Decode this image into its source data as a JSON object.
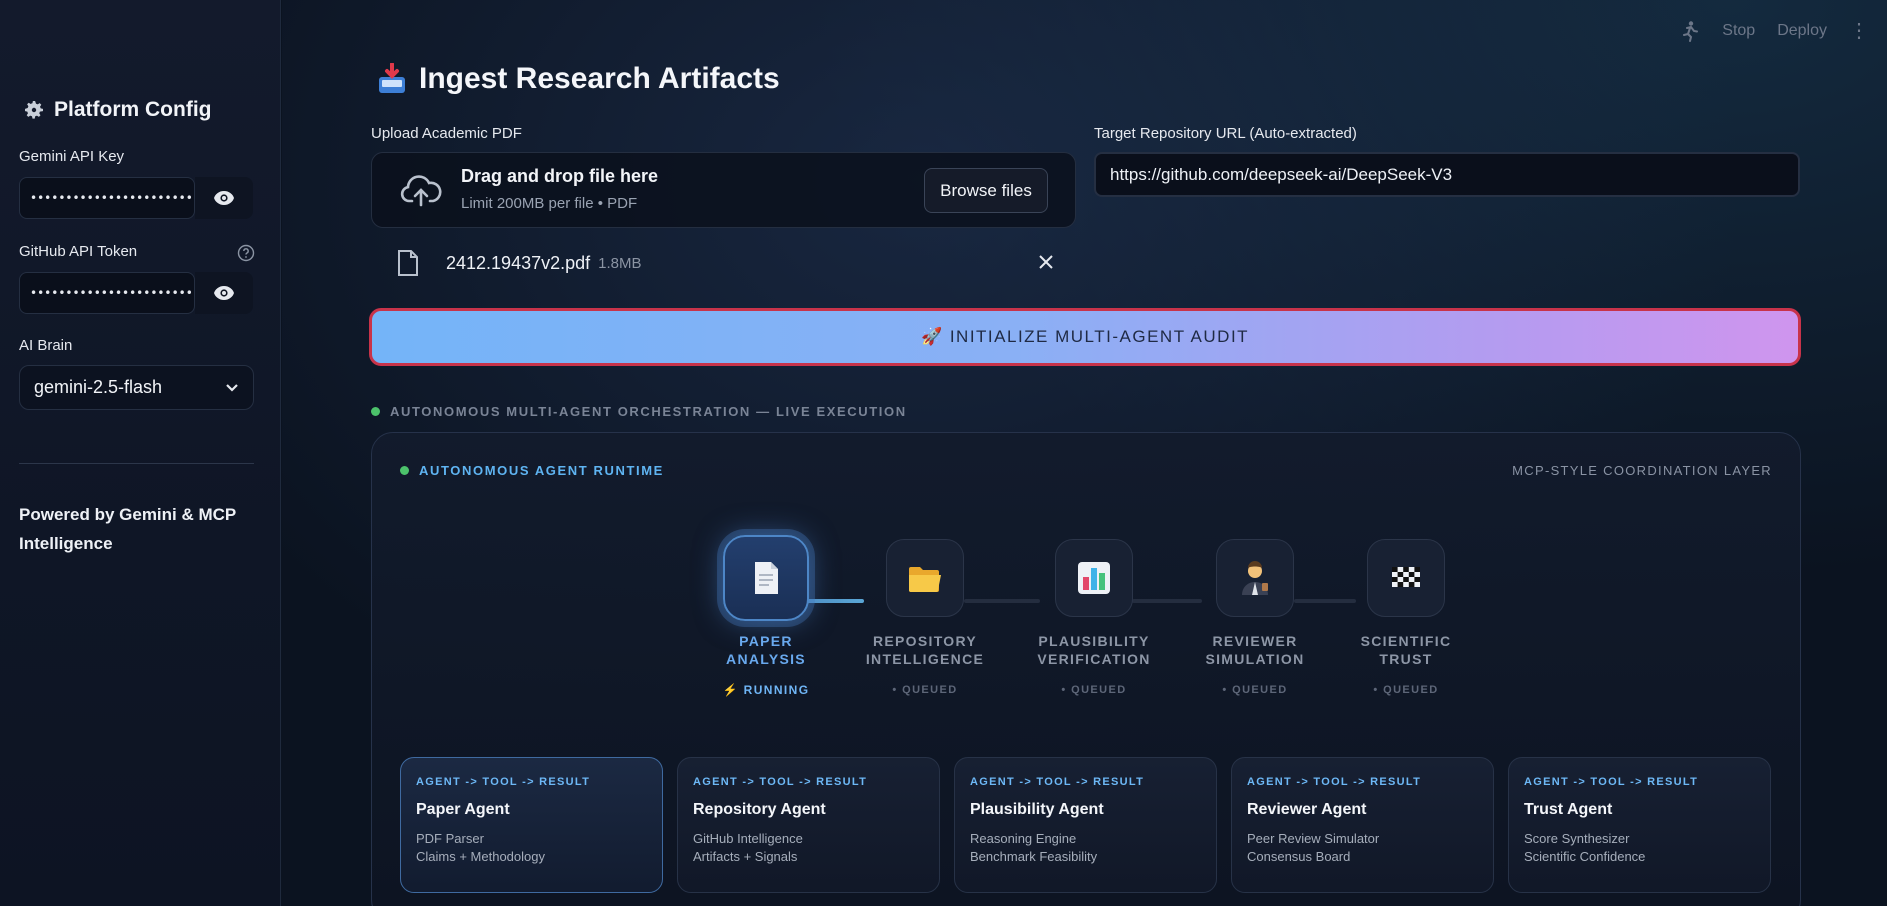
{
  "sidebar": {
    "title": "Platform Config",
    "gemini_label": "Gemini API Key",
    "gemini_value": "•••••••••••••••••••••••••••••••••••••",
    "github_label": "GitHub API Token",
    "github_value": "•••••••••••••••••••••••••••••••••••••",
    "brain_label": "AI Brain",
    "brain_value": "gemini-2.5-flash",
    "powered": "Powered by Gemini & MCP Intelligence"
  },
  "topbar": {
    "stop": "Stop",
    "deploy": "Deploy",
    "menu": "⋮"
  },
  "main": {
    "title": "Ingest Research Artifacts",
    "upload_label": "Upload Academic PDF",
    "drop_main": "Drag and drop file here",
    "drop_sub": "Limit 200MB per file • PDF",
    "browse": "Browse files",
    "repo_label": "Target Repository URL (Auto-extracted)",
    "repo_value": "https://github.com/deepseek-ai/DeepSeek-V3",
    "file_name": "2412.19437v2.pdf",
    "file_size": "1.8MB",
    "init_button": "🚀 INITIALIZE MULTI-AGENT AUDIT",
    "section_heading": "AUTONOMOUS MULTI-AGENT ORCHESTRATION — LIVE EXECUTION"
  },
  "runtime": {
    "title": "AUTONOMOUS AGENT RUNTIME",
    "right_label": "MCP-STYLE COORDINATION LAYER",
    "stages": [
      {
        "label_1": "PAPER",
        "label_2": "ANALYSIS",
        "status": "⚡ RUNNING",
        "icon": "document-icon"
      },
      {
        "label_1": "REPOSITORY",
        "label_2": "INTELLIGENCE",
        "status": "• QUEUED",
        "icon": "folder-icon"
      },
      {
        "label_1": "PLAUSIBILITY",
        "label_2": "VERIFICATION",
        "status": "• QUEUED",
        "icon": "bar-chart-icon"
      },
      {
        "label_1": "REVIEWER",
        "label_2": "SIMULATION",
        "status": "• QUEUED",
        "icon": "reviewer-icon"
      },
      {
        "label_1": "SCIENTIFIC",
        "label_2": "TRUST",
        "status": "• QUEUED",
        "icon": "checkered-flag-icon"
      }
    ],
    "cards": [
      {
        "tag": "AGENT -> TOOL -> RESULT",
        "title": "Paper Agent",
        "line1": "PDF Parser",
        "line2": "Claims + Methodology"
      },
      {
        "tag": "AGENT -> TOOL -> RESULT",
        "title": "Repository Agent",
        "line1": "GitHub Intelligence",
        "line2": "Artifacts + Signals"
      },
      {
        "tag": "AGENT -> TOOL -> RESULT",
        "title": "Plausibility Agent",
        "line1": "Reasoning Engine",
        "line2": "Benchmark Feasibility"
      },
      {
        "tag": "AGENT -> TOOL -> RESULT",
        "title": "Reviewer Agent",
        "line1": "Peer Review Simulator",
        "line2": "Consensus Board"
      },
      {
        "tag": "AGENT -> TOOL -> RESULT",
        "title": "Trust Agent",
        "line1": "Score Synthesizer",
        "line2": "Scientific Confidence"
      }
    ]
  },
  "colors": {
    "accent": "#6fb5f5",
    "live_dot": "#4cc26b",
    "button_border": "#c8334a"
  }
}
